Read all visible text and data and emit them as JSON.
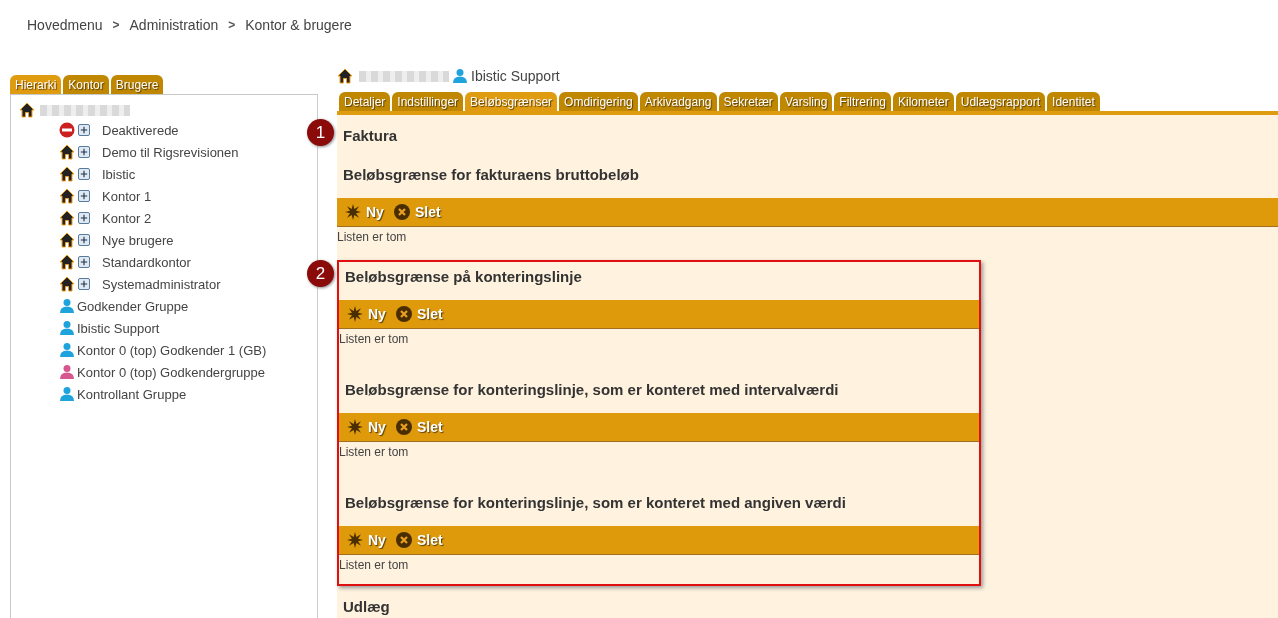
{
  "breadcrumb": {
    "separator": ">",
    "items": [
      "Hovedmenu",
      "Administration",
      "Kontor & brugere"
    ]
  },
  "side_tabs": [
    {
      "label": "Hierarki",
      "selected": true
    },
    {
      "label": "Kontor",
      "selected": false
    },
    {
      "label": "Brugere",
      "selected": false
    }
  ],
  "tree": {
    "root": {
      "kind": "office",
      "redacted": true,
      "children": [
        {
          "kind": "blocked",
          "label": "Deaktiverede",
          "expandable": true
        },
        {
          "kind": "office",
          "label": "Demo til Rigsrevisionen",
          "expandable": true
        },
        {
          "kind": "office",
          "label": "Ibistic",
          "expandable": true
        },
        {
          "kind": "office",
          "label": "Kontor 1",
          "expandable": true
        },
        {
          "kind": "office",
          "label": "Kontor 2",
          "expandable": true
        },
        {
          "kind": "office",
          "label": "Nye brugere",
          "expandable": true
        },
        {
          "kind": "office",
          "label": "Standardkontor",
          "expandable": true
        },
        {
          "kind": "office",
          "label": "Systemadministrator",
          "expandable": true
        },
        {
          "kind": "user",
          "label": "Godkender Gruppe",
          "color": "#1fa3dc"
        },
        {
          "kind": "user",
          "label": "Ibistic Support",
          "color": "#1fa3dc"
        },
        {
          "kind": "user",
          "label": "Kontor 0 (top) Godkender 1 (GB)",
          "color": "#1fa3dc"
        },
        {
          "kind": "user",
          "label": "Kontor 0 (top) Godkendergruppe",
          "color": "#d6578f"
        },
        {
          "kind": "user",
          "label": "Kontrollant Gruppe",
          "color": "#1fa3dc"
        }
      ]
    }
  },
  "detail": {
    "path_redacted": true,
    "user": "Ibistic Support",
    "tabs": [
      {
        "label": "Detaljer",
        "selected": false
      },
      {
        "label": "Indstillinger",
        "selected": false
      },
      {
        "label": "Beløbsgrænser",
        "selected": true
      },
      {
        "label": "Omdirigering",
        "selected": false
      },
      {
        "label": "Arkivadgang",
        "selected": false
      },
      {
        "label": "Sekretær",
        "selected": false
      },
      {
        "label": "Varsling",
        "selected": false
      },
      {
        "label": "Filtrering",
        "selected": false
      },
      {
        "label": "Kilometer",
        "selected": false
      },
      {
        "label": "Udlægsrapport",
        "selected": false
      },
      {
        "label": "Identitet",
        "selected": false
      }
    ],
    "blocks": [
      {
        "kind": "heading",
        "text": "Faktura",
        "marker": "1"
      },
      {
        "kind": "limit",
        "title": "Beløbsgrænse for fakturaens bruttobeløb",
        "actions": [
          "Ny",
          "Slet"
        ],
        "empty": "Listen er tom"
      },
      {
        "kind": "callout",
        "marker": "2",
        "limits": [
          {
            "title": "Beløbsgrænse på konteringslinje",
            "actions": [
              "Ny",
              "Slet"
            ],
            "empty": "Listen er tom"
          },
          {
            "title": "Beløbsgrænse for konteringslinje, som er konteret med intervalværdi",
            "actions": [
              "Ny",
              "Slet"
            ],
            "empty": "Listen er tom"
          },
          {
            "title": "Beløbsgrænse for konteringslinje, som er konteret med angiven værdi",
            "actions": [
              "Ny",
              "Slet"
            ],
            "empty": "Listen er tom"
          }
        ]
      },
      {
        "kind": "heading",
        "text": "Udlæg"
      }
    ]
  }
}
